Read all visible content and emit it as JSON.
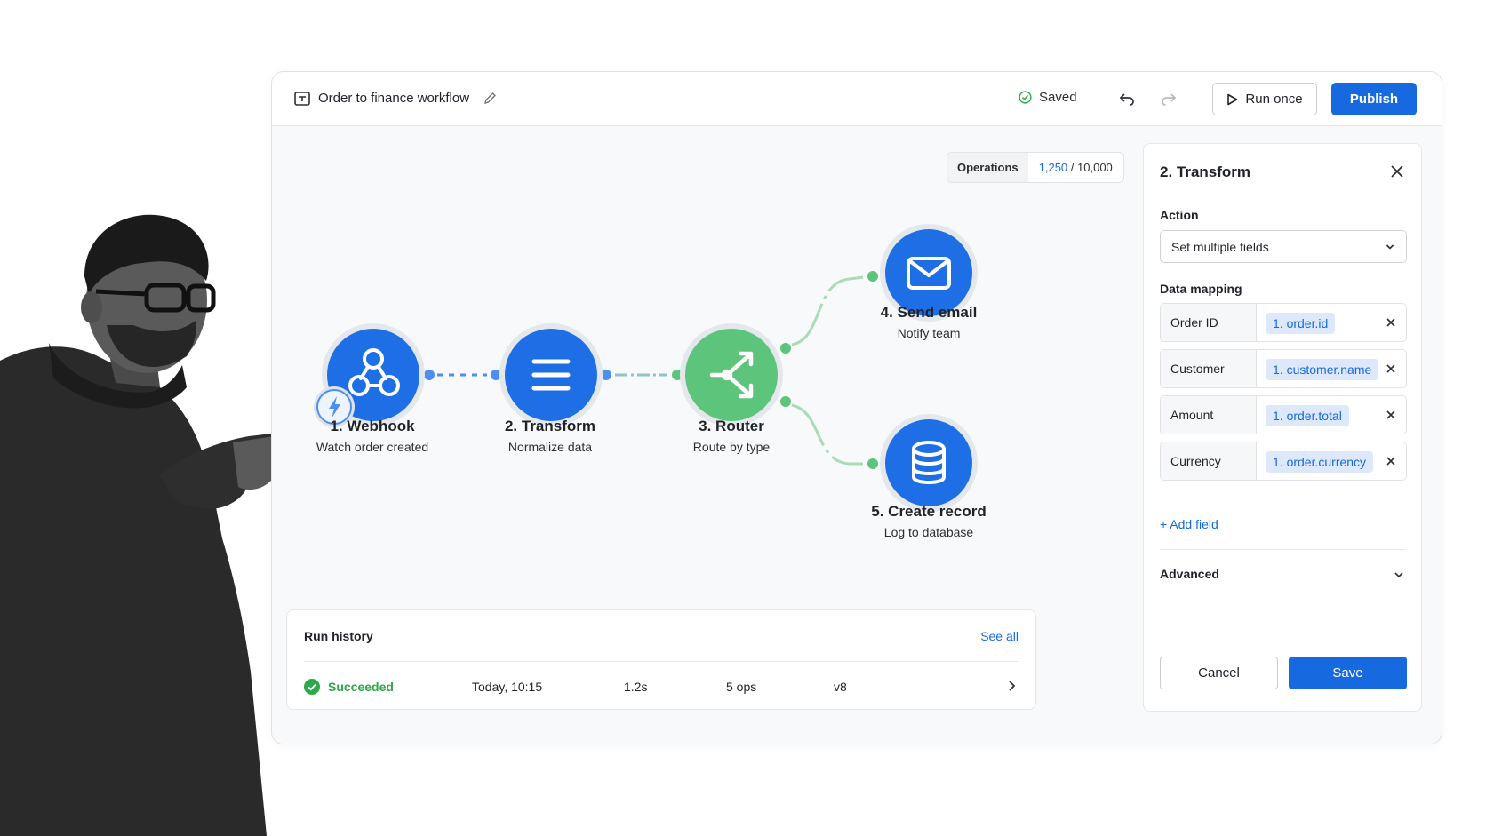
{
  "header": {
    "workflow_title": "Order to finance workflow",
    "saved_label": "Saved",
    "run_once_label": "Run once",
    "publish_label": "Publish"
  },
  "operations": {
    "label": "Operations",
    "used": "1,250",
    "separator": " / ",
    "limit": "10,000"
  },
  "nodes": [
    {
      "title": "1. Webhook",
      "subtitle": "Watch order created",
      "icon": "webhook-icon",
      "color": "#1e6fe6"
    },
    {
      "title": "2. Transform",
      "subtitle": "Normalize data",
      "icon": "transform-icon",
      "color": "#1e6fe6"
    },
    {
      "title": "3. Router",
      "subtitle": "Route by type",
      "icon": "router-icon",
      "color": "#5cc47b"
    },
    {
      "title": "4. Send email",
      "subtitle": "Notify team",
      "icon": "mail-icon",
      "color": "#1e6fe6"
    },
    {
      "title": "5. Create record",
      "subtitle": "Log to database",
      "icon": "database-icon",
      "color": "#1e6fe6"
    }
  ],
  "history": {
    "title": "Run history",
    "see_all": "See all",
    "rows": [
      {
        "status": "Succeeded",
        "time": "Today, 10:15",
        "duration": "1.2s",
        "ops": "5 ops",
        "version": "v8"
      }
    ]
  },
  "panel": {
    "title": "2. Transform",
    "action_label": "Action",
    "action_value": "Set multiple fields",
    "mapping_label": "Data mapping",
    "mappings": [
      {
        "key": "Order ID",
        "value": "1. order.id"
      },
      {
        "key": "Customer",
        "value": "1. customer.name"
      },
      {
        "key": "Amount",
        "value": "1. order.total"
      },
      {
        "key": "Currency",
        "value": "1. order.currency"
      }
    ],
    "add_field": "+ Add field",
    "advanced": "Advanced",
    "cancel": "Cancel",
    "save": "Save"
  },
  "colors": {
    "accent": "#1769e0",
    "success": "#2ea84a",
    "router": "#5cc47b"
  }
}
